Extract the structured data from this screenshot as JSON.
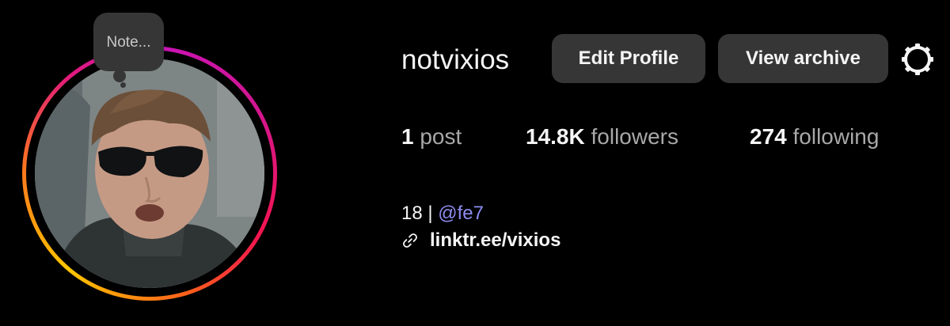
{
  "profile": {
    "username": "notvixios",
    "note_placeholder": "Note...",
    "edit_profile_label": "Edit Profile",
    "view_archive_label": "View archive",
    "settings_icon": "gear-icon"
  },
  "stats": {
    "posts_count": "1",
    "posts_label": "post",
    "followers_count": "14.8K",
    "followers_label": "followers",
    "following_count": "274",
    "following_label": "following"
  },
  "bio": {
    "text": "18 | ",
    "mention": "@fe7",
    "link_icon": "link-icon",
    "link": "linktr.ee/vixios"
  },
  "colors": {
    "background": "#000000",
    "button": "#363636",
    "text_primary": "#f5f5f5",
    "text_secondary": "#a8a8a8",
    "mention": "#8c8cf0",
    "ring_gradient": [
      "#c913b9",
      "#f5154f",
      "#ffc600"
    ]
  }
}
